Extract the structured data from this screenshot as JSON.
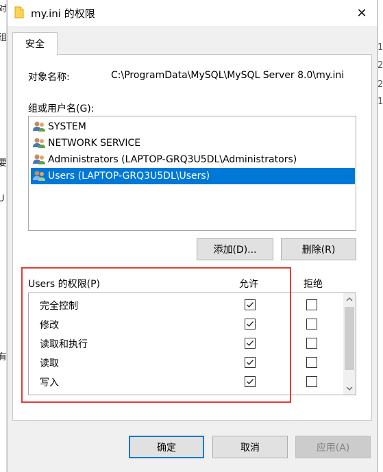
{
  "window": {
    "title": "my.ini 的权限",
    "close_glyph": "✕"
  },
  "tab": {
    "label": "安全"
  },
  "object": {
    "label": "对象名称:",
    "value": "C:\\ProgramData\\MySQL\\MySQL Server 8.0\\my.ini"
  },
  "groups": {
    "label": "组或用户名(G):",
    "items": [
      {
        "label": "SYSTEM",
        "icon": "users-icon",
        "selected": false
      },
      {
        "label": "NETWORK SERVICE",
        "icon": "users-icon",
        "selected": false
      },
      {
        "label": "Administrators (LAPTOP-GRQ3U5DL\\Administrators)",
        "icon": "users-icon",
        "selected": false
      },
      {
        "label": "Users (LAPTOP-GRQ3U5DL\\Users)",
        "icon": "users-icon",
        "selected": true
      }
    ],
    "add_label": "添加(D)...",
    "remove_label": "删除(R)"
  },
  "permissions": {
    "label": "Users 的权限(P)",
    "allow_label": "允许",
    "deny_label": "拒绝",
    "rows": [
      {
        "name": "完全控制",
        "allow": true,
        "deny": false
      },
      {
        "name": "修改",
        "allow": true,
        "deny": false
      },
      {
        "name": "读取和执行",
        "allow": true,
        "deny": false
      },
      {
        "name": "读取",
        "allow": true,
        "deny": false
      },
      {
        "name": "写入",
        "allow": true,
        "deny": false
      }
    ]
  },
  "footer": {
    "ok_label": "确定",
    "cancel_label": "取消",
    "apply_label": "应用(A)"
  },
  "background": {
    "left_glyphs": [
      "对",
      "组",
      "要",
      "U",
      "有"
    ],
    "right_glyphs": [
      "1",
      "2",
      "2",
      "1"
    ]
  },
  "colors": {
    "selection": "#0078d7",
    "highlight_box": "#e53935"
  }
}
